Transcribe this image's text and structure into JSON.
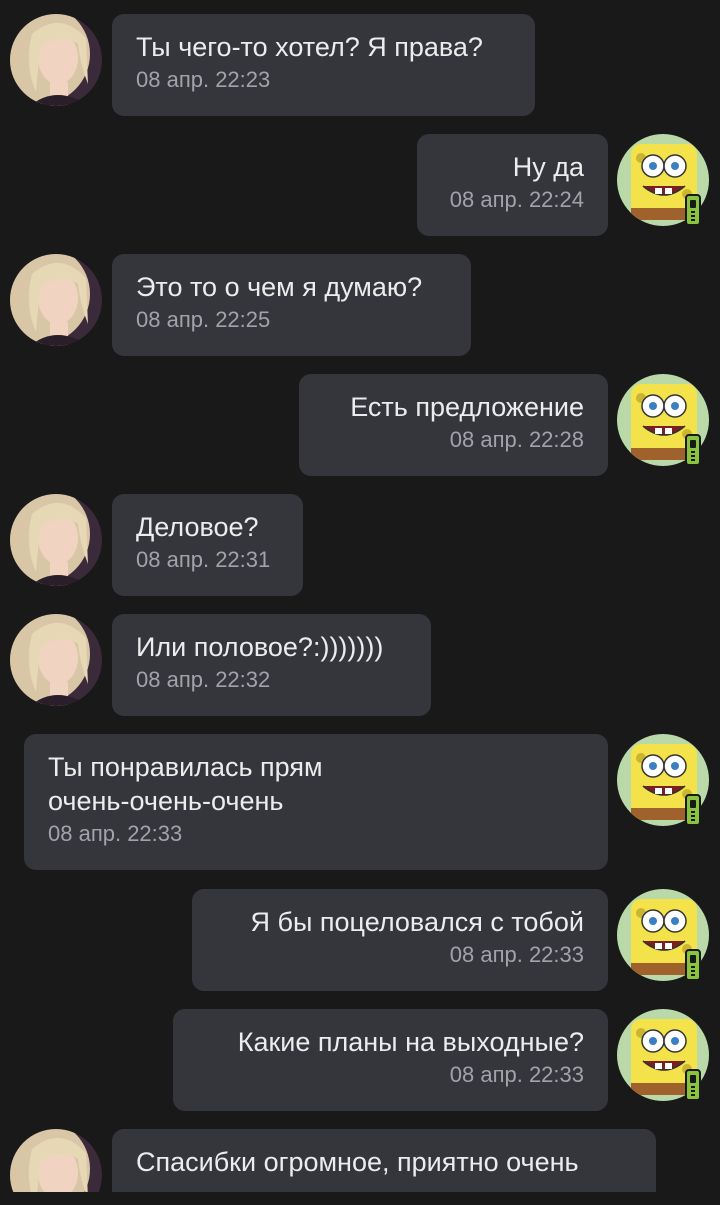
{
  "messages": [
    {
      "side": "in",
      "text": "Ты чего-то хотел? Я права?",
      "time": "08 апр. 22:23"
    },
    {
      "side": "out",
      "text": "Ну да",
      "time": "08 апр. 22:24"
    },
    {
      "side": "in",
      "text": "Это то о чем я думаю?",
      "time": "08 апр. 22:25"
    },
    {
      "side": "out",
      "text": "Есть предложение",
      "time": "08 апр. 22:28"
    },
    {
      "side": "in",
      "text": "Деловое?",
      "time": "08 апр. 22:31"
    },
    {
      "side": "in",
      "text": "Или половое?:)))))))",
      "time": "08 апр. 22:32"
    },
    {
      "side": "out",
      "text": "Ты понравилась прям очень-очень-очень",
      "time": "08 апр. 22:33"
    },
    {
      "side": "out",
      "text": "Я бы поцеловался с тобой",
      "time": "08 апр. 22:33"
    },
    {
      "side": "out",
      "text": "Какие планы на выходные?",
      "time": "08 апр. 22:33"
    },
    {
      "side": "in",
      "text": "Спасибки огромное, приятно очень",
      "time": ""
    }
  ],
  "icons": {
    "incoming_avatar": "woman-avatar-icon",
    "outgoing_avatar": "spongebob-avatar-icon",
    "mobile_badge": "mobile-phone-icon"
  },
  "colors": {
    "background": "#19191a",
    "bubble": "#35363b",
    "text": "#ececee",
    "time": "#a2a3aa",
    "mobile_badge": "#8ac43f"
  }
}
